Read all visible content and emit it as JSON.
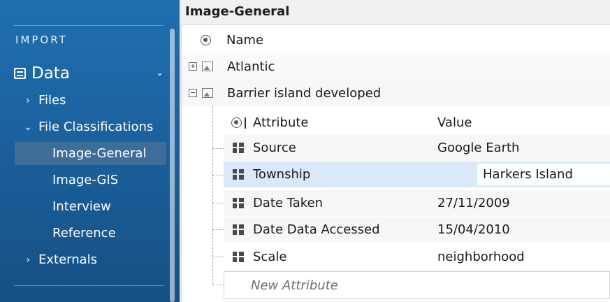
{
  "sidebar": {
    "section": "IMPORT",
    "data_label": "Data",
    "items": [
      {
        "label": "Files",
        "arrow": "›"
      },
      {
        "label": "File Classifications",
        "arrow": "⌄"
      }
    ],
    "classifications": [
      {
        "label": "Image-General"
      },
      {
        "label": "Image-GIS"
      },
      {
        "label": "Interview"
      },
      {
        "label": "Reference"
      }
    ],
    "externals": {
      "label": "Externals",
      "arrow": "›"
    }
  },
  "main": {
    "title": "Image-General",
    "name_header": "Name",
    "nodes": [
      {
        "label": "Atlantic",
        "expander": "+"
      },
      {
        "label": "Barrier island developed",
        "expander": "−"
      }
    ],
    "attr_headers": {
      "attribute": "Attribute",
      "value": "Value"
    },
    "attributes": [
      {
        "name": "Source",
        "value": "Google Earth"
      },
      {
        "name": "Township",
        "value": "Harkers Island"
      },
      {
        "name": "Date Taken",
        "value": "27/11/2009"
      },
      {
        "name": "Date Data Accessed",
        "value": "15/04/2010"
      },
      {
        "name": "Scale",
        "value": "neighborhood"
      }
    ],
    "new_attribute_placeholder": "New Attribute"
  },
  "colors": {
    "sidebar_bg": "#1c64a5",
    "selected_item": "#3d6d98",
    "highlight_row": "#d9e9f9"
  }
}
